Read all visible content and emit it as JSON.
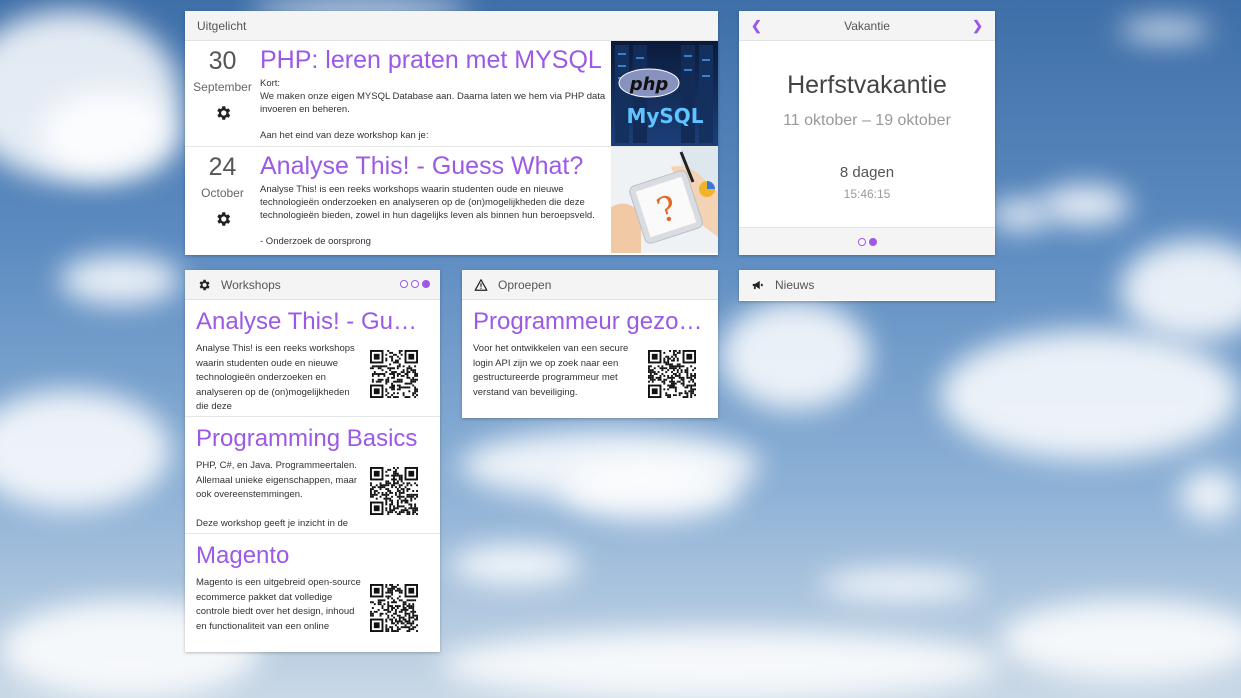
{
  "colors": {
    "accent": "#9b59e6",
    "panel_header": "#f4f4f4"
  },
  "featured": {
    "header": "Uitgelicht",
    "items": [
      {
        "day": "30",
        "month": "September",
        "icon": "gear-icon",
        "title": "PHP: leren praten met MYSQL",
        "text": "Kort:\nWe maken onze eigen MYSQL Database aan. Daarna laten we hem via PHP data invoeren en beheren.\n\nAan het eind van deze workshop kan je:",
        "image_labels": [
          "php",
          "MySQL"
        ]
      },
      {
        "day": "24",
        "month": "October",
        "icon": "gear-icon",
        "title": "Analyse This! - Guess What?",
        "text": "Analyse This! is een reeks workshops waarin studenten oude en nieuwe technologieën onderzoeken en analyseren op de (on)mogelijkheden die deze technologieën bieden, zowel in hun dagelijks leven als binnen hun beroepsveld.\n\n- Onderzoek de oorsprong",
        "image_labels": [
          "?"
        ]
      }
    ]
  },
  "vacation": {
    "header": "Vakantie",
    "title": "Herfstvakantie",
    "range": "11 oktober – 19 oktober",
    "days": "8 dagen",
    "time": "15:46:15"
  },
  "workshops": {
    "header": "Workshops",
    "items": [
      {
        "title": "Analyse This! - Guess What?",
        "text": "Analyse This! is een reeks workshops waarin studenten oude en nieuwe technologieën onderzoeken en analyseren op de (on)mogelijkheden die deze"
      },
      {
        "title": "Programming Basics",
        "text": "PHP, C#, en Java. Programmeertalen. Allemaal unieke eigenschappen, maar ook overeenstemmingen.\n\nDeze workshop geeft je inzicht in de"
      },
      {
        "title": "Magento",
        "text": "Magento is een uitgebreid open-source ecommerce pakket dat volledige controle biedt over het design, inhoud en functionaliteit van een online"
      }
    ]
  },
  "oproepen": {
    "header": "Oproepen",
    "items": [
      {
        "title": "Programmeur gezocht",
        "text": "Voor het ontwikkelen van een secure login API zijn we op zoek naar een gestructureerde programmeur met verstand van beveiliging."
      }
    ]
  },
  "news": {
    "header": "Nieuws"
  }
}
